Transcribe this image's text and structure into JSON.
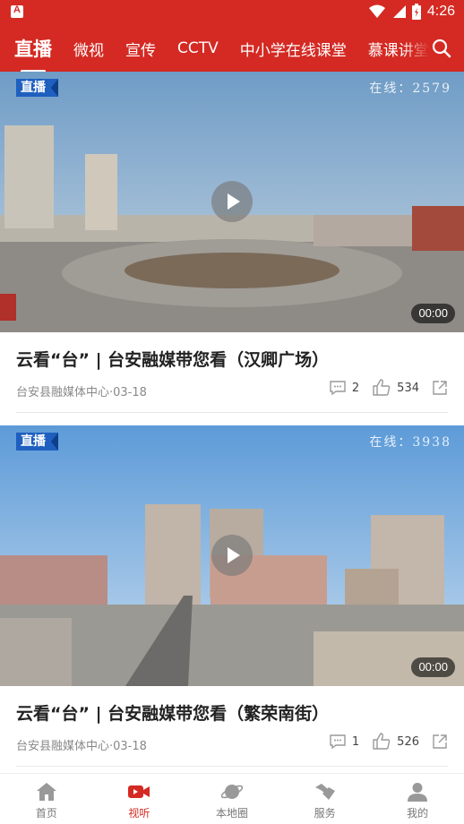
{
  "statusbar": {
    "time": "4:26"
  },
  "topnav": {
    "tabs": [
      "直播",
      "微视",
      "宣传",
      "CCTV",
      "中小学在线课堂",
      "慕课讲堂"
    ],
    "active_index": 0
  },
  "feed": [
    {
      "badge": "直播",
      "online": "在线：2579",
      "duration": "00:00",
      "title": "云看“台” | 台安融媒带您看（汉卿广场）",
      "source": "台安县融媒体中心·03-18",
      "comments": "2",
      "likes": "534"
    },
    {
      "badge": "直播",
      "online": "在线：3938",
      "duration": "00:00",
      "title": "云看“台” | 台安融媒带您看（繁荣南街）",
      "source": "台安县融媒体中心·03-18",
      "comments": "1",
      "likes": "526"
    }
  ],
  "bottomnav": {
    "items": [
      "首页",
      "视听",
      "本地圈",
      "服务",
      "我的"
    ],
    "active_index": 1
  },
  "colors": {
    "brand": "#d42a23",
    "live_badge": "#1e5fbf"
  },
  "icons": [
    "search-icon",
    "comment-icon",
    "like-icon",
    "share-icon",
    "home-icon",
    "video-icon",
    "planet-icon",
    "handshake-icon",
    "user-icon"
  ]
}
